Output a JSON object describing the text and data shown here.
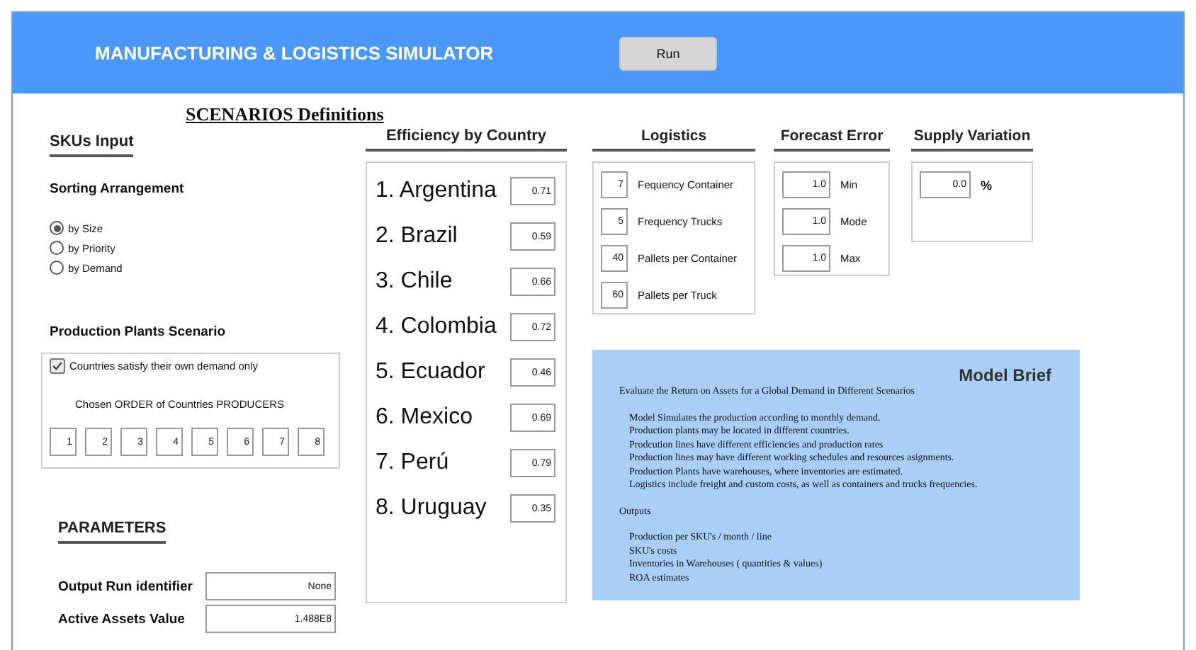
{
  "window": {
    "title": "MANUFACTURING & LOGISTICS SIMULATOR",
    "run_button": "Run"
  },
  "scenarios_title": "SCENARIOS Definitions",
  "skus_input": {
    "heading": "SKUs Input",
    "sorting_heading": "Sorting Arrangement",
    "options": [
      {
        "label": "by Size",
        "selected": true
      },
      {
        "label": "by Priority",
        "selected": false
      },
      {
        "label": "by Demand",
        "selected": false
      }
    ]
  },
  "production_plants": {
    "heading": "Production Plants Scenario",
    "own_demand": {
      "label": "Countries satisfy their own demand only",
      "checked": true
    },
    "order_label": "Chosen ORDER of Countries PRODUCERS",
    "order": [
      "1",
      "2",
      "3",
      "4",
      "5",
      "6",
      "7",
      "8"
    ]
  },
  "parameters": {
    "heading": "PARAMETERS",
    "fields": [
      {
        "label": "Output Run identifier",
        "value": "None"
      },
      {
        "label": "Active Assets Value",
        "value": "1.488E8"
      }
    ]
  },
  "efficiency": {
    "heading": "Efficiency by Country",
    "countries": [
      {
        "name": "1. Argentina",
        "value": "0.71"
      },
      {
        "name": "2. Brazil",
        "value": "0.59"
      },
      {
        "name": "3. Chile",
        "value": "0.66"
      },
      {
        "name": "4. Colombia",
        "value": "0.72"
      },
      {
        "name": "5. Ecuador",
        "value": "0.46"
      },
      {
        "name": "6. Mexico",
        "value": "0.69"
      },
      {
        "name": "7. Perú",
        "value": "0.79"
      },
      {
        "name": "8. Uruguay",
        "value": "0.35"
      }
    ]
  },
  "logistics": {
    "heading": "Logistics",
    "fields": [
      {
        "value": "7",
        "label": "Fequency Container"
      },
      {
        "value": "5",
        "label": "Frequency Trucks"
      },
      {
        "value": "40",
        "label": "Pallets per Container"
      },
      {
        "value": "60",
        "label": "Pallets per Truck"
      }
    ]
  },
  "forecast_error": {
    "heading": "Forecast Error",
    "fields": [
      {
        "value": "1.0",
        "label": "Min"
      },
      {
        "value": "1.0",
        "label": "Mode"
      },
      {
        "value": "1.0",
        "label": "Max"
      }
    ]
  },
  "supply_variation": {
    "heading": "Supply Variation",
    "value": "0.0",
    "unit": "%"
  },
  "model_brief": {
    "title": "Model Brief",
    "intro": "Evaluate the Return on Assets for a Global Demand in Different Scenarios",
    "points": [
      "Model Simulates the production according to monthly demand.",
      "Production plants may be located in different countries.",
      "Prodcution lines have different efficiencies and production rates",
      "Production lines may have different working schedules and resources asignments.",
      "Production Plants have warehouses, where inventories are estimated.",
      "Logistics include freight and custom costs, as well as containers and trucks frequencies."
    ],
    "outputs_heading": "Outputs",
    "outputs": [
      "Production per SKU's / month / line",
      "SKU's costs",
      "Inventories in Warehouses ( quantities & values)",
      "ROA estimates"
    ]
  }
}
